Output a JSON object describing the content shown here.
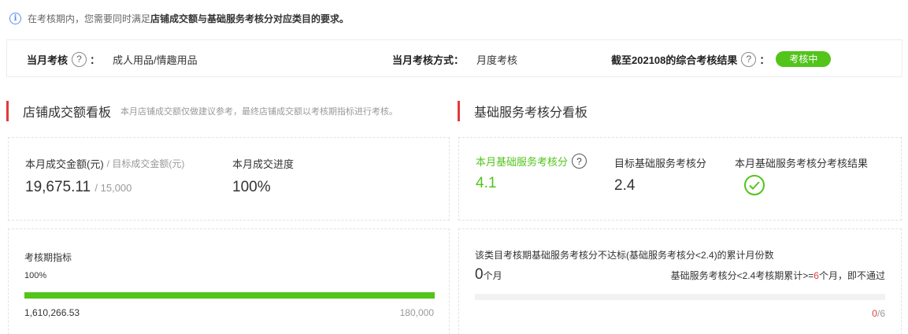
{
  "notice": {
    "text_prefix": "在考核期内，您需要同时满足",
    "text_bold": "店铺成交额与基础服务考核分对应类目的要求。"
  },
  "summary": {
    "month_label": "当月考核",
    "month_value": "成人用品/情趣用品",
    "method_label": "当月考核方式：",
    "method_value": "月度考核",
    "result_label": "截至202108的综合考核结果",
    "result_badge": "考核中",
    "help_glyph": "?",
    "colon": "："
  },
  "store": {
    "title": "店铺成交额看板",
    "desc": "本月店铺成交额仅做建议参考，最终店铺成交额以考核期指标进行考核。",
    "amount_label": "本月成交金额(元)",
    "target_label": "/ 目标成交金额(元)",
    "amount_value": "19,675.11",
    "target_value": "/ 15,000",
    "progress_label": "本月成交进度",
    "progress_value": "100%",
    "period_label": "考核期指标",
    "period_percent_text": "100%",
    "period_progress": 1.0,
    "period_current": "1,610,266.53",
    "period_target": "180,000"
  },
  "service": {
    "title": "基础服务考核分看板",
    "score_label": "本月基础服务考核分",
    "score_value": "4.1",
    "target_label": "目标基础服务考核分",
    "target_value": "2.4",
    "result_label": "本月基础服务考核分考核结果",
    "fail_label": "该类目考核期基础服务考核分不达标(基础服务考核分<2.4)的累计月份数",
    "fail_count": "0",
    "fail_unit": "个月",
    "rule_prefix": "基础服务考核分<2.4考核期累计>=",
    "rule_num": "6",
    "rule_suffix": "个月，即不通过",
    "progress": 0.0,
    "count_current": "0",
    "count_total": "/6"
  },
  "colors": {
    "accent": "#52c41a",
    "section_bar": "#e03c3c",
    "info": "#5b8def",
    "alert": "#e03c3c"
  }
}
